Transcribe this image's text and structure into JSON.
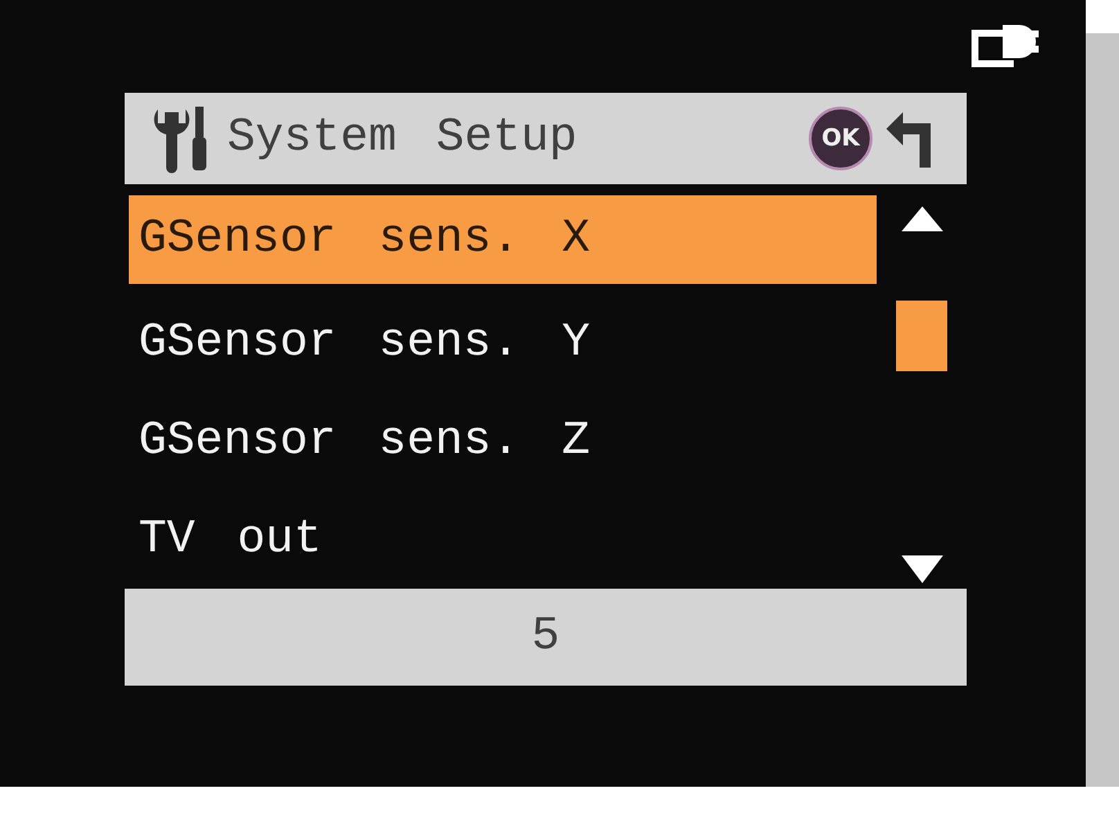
{
  "header": {
    "title": "System Setup",
    "ok_label": "OK"
  },
  "menu": {
    "items": [
      {
        "label": "GSensor sens. X",
        "selected": true
      },
      {
        "label": "GSensor sens. Y",
        "selected": false
      },
      {
        "label": "GSensor sens. Z",
        "selected": false
      },
      {
        "label": "TV out",
        "selected": false
      }
    ]
  },
  "value_bar": {
    "value": "5"
  }
}
